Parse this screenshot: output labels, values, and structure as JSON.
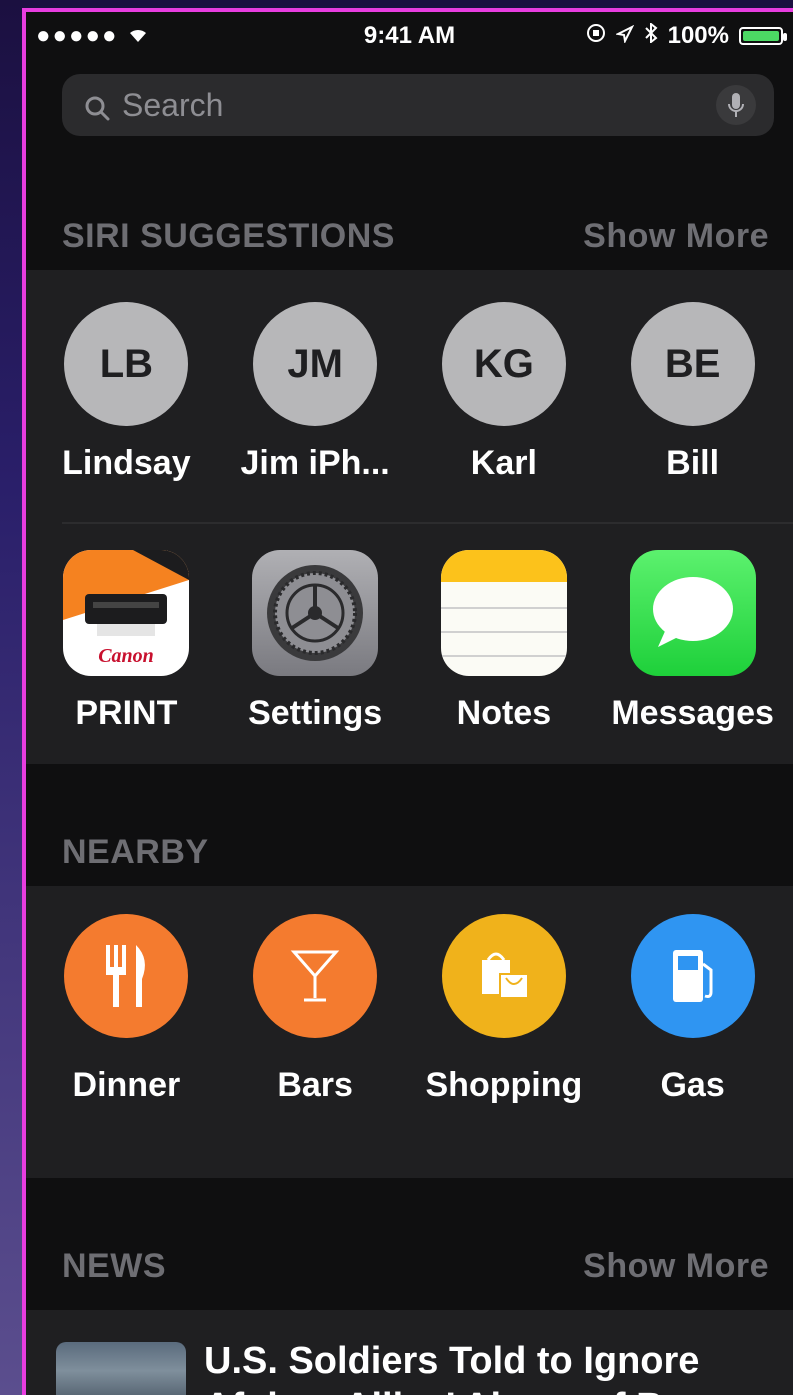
{
  "status_bar": {
    "signal": "●●●●● ",
    "time": "9:41 AM",
    "battery": "100%"
  },
  "search": {
    "placeholder": "Search"
  },
  "siri_suggestions": {
    "header": "SIRI SUGGESTIONS",
    "show_more": "Show More",
    "contacts": [
      {
        "initials": "LB",
        "name": "Lindsay"
      },
      {
        "initials": "JM",
        "name": "Jim iPh..."
      },
      {
        "initials": "KG",
        "name": "Karl"
      },
      {
        "initials": "BE",
        "name": "Bill"
      }
    ],
    "apps": [
      {
        "name": "PRINT",
        "icon": "canon-print-icon"
      },
      {
        "name": "Settings",
        "icon": "settings-gear-icon"
      },
      {
        "name": "Notes",
        "icon": "notes-icon"
      },
      {
        "name": "Messages",
        "icon": "messages-icon"
      }
    ]
  },
  "nearby": {
    "header": "NEARBY",
    "items": [
      {
        "name": "Dinner",
        "icon": "fork-knife-icon",
        "color": "#f47b2f"
      },
      {
        "name": "Bars",
        "icon": "martini-icon",
        "color": "#f47b2f"
      },
      {
        "name": "Shopping",
        "icon": "shopping-bags-icon",
        "color": "#f0b21b"
      },
      {
        "name": "Gas",
        "icon": "gas-pump-icon",
        "color": "#2f95f2"
      }
    ]
  },
  "news": {
    "header": "NEWS",
    "show_more": "Show More",
    "items": [
      {
        "headline": "U.S. Soldiers Told to Ignore Afghan Allies’ Abuse of B..."
      }
    ]
  },
  "canon_brand": "Canon"
}
